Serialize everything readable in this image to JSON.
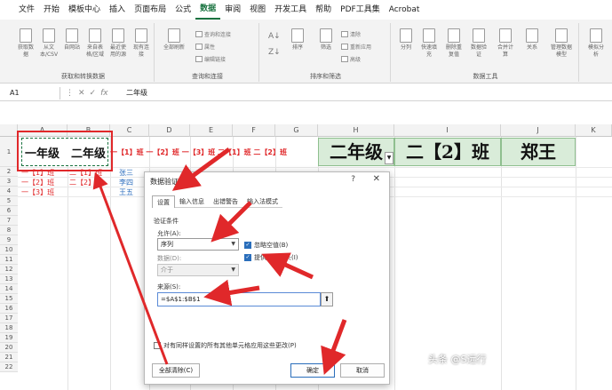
{
  "menu": [
    "文件",
    "开始",
    "模板中心",
    "插入",
    "页面布局",
    "公式",
    "数据",
    "审阅",
    "视图",
    "开发工具",
    "帮助",
    "PDF工具集",
    "Acrobat"
  ],
  "menu_active_index": 6,
  "ribbon": {
    "group1": {
      "label": "获取和转换数据",
      "buttons": [
        "获取数据",
        "从文本/CSV",
        "自网站",
        "来自表格/区域",
        "最近使用的源",
        "现有连接"
      ]
    },
    "group2": {
      "label": "查询和连接",
      "buttons": [
        "全部刷新"
      ],
      "small": [
        "查询和连接",
        "属性",
        "编辑链接"
      ]
    },
    "group3": {
      "label": "排序和筛选",
      "buttons": [
        "排序",
        "筛选"
      ],
      "small": [
        "清除",
        "重新应用",
        "高级"
      ]
    },
    "group4": {
      "label": "数据工具",
      "buttons": [
        "分列",
        "快速填充",
        "删除重复值",
        "数据验证",
        "合并计算",
        "关系",
        "管理数据模型"
      ]
    },
    "group5": {
      "buttons": [
        "模拟分析"
      ]
    }
  },
  "formula_bar": {
    "name_box": "A1",
    "tools": [
      "⋮",
      "✕",
      "✓",
      "fx"
    ],
    "content": "二年级"
  },
  "columns": [
    "A",
    "B",
    "C",
    "D",
    "E",
    "F",
    "G",
    "H",
    "I",
    "J",
    "K"
  ],
  "rows": [
    "1",
    "2",
    "3",
    "4",
    "5",
    "6",
    "7",
    "8",
    "9",
    "10",
    "11",
    "12",
    "13",
    "14",
    "15",
    "16",
    "17",
    "18",
    "19",
    "20",
    "21",
    "22"
  ],
  "cells": {
    "a1": "一年级",
    "b1": "二年级",
    "row1_tail": "一【1】班 一【2】班 一【3】班 二【1】班 二【2】班",
    "a2": "一【1】班",
    "a3": "一【2】班",
    "a4": "一【3】班",
    "b2": "二【1】班",
    "b3": "二【2】",
    "c2": "张三",
    "c3": "李四",
    "c4": "王五",
    "h1": "二年级",
    "i1": "二【2】班",
    "j1": "郑王"
  },
  "dialog": {
    "title": "数据验证",
    "help": "?",
    "close": "✕",
    "tabs": [
      "设置",
      "输入信息",
      "出错警告",
      "输入法模式"
    ],
    "group_title": "验证条件",
    "allow_label": "允许(A):",
    "allow_value": "序列",
    "ignore_blank": "忽略空值(B)",
    "dropdown": "提供下拉箭头(I)",
    "data_label": "数据(D):",
    "data_value": "介于",
    "source_label": "来源(S):",
    "source_value": "=$A$1:$B$1",
    "apply_all": "对有同样设置的所有其他单元格应用这些更改(P)",
    "clear_all": "全部清除(C)",
    "ok": "确定",
    "cancel": "取消"
  },
  "watermark": "头条 @S远行",
  "colors": {
    "accent": "#1a7340",
    "annotation": "#e0282a",
    "highlight": "#d9ecd9"
  }
}
